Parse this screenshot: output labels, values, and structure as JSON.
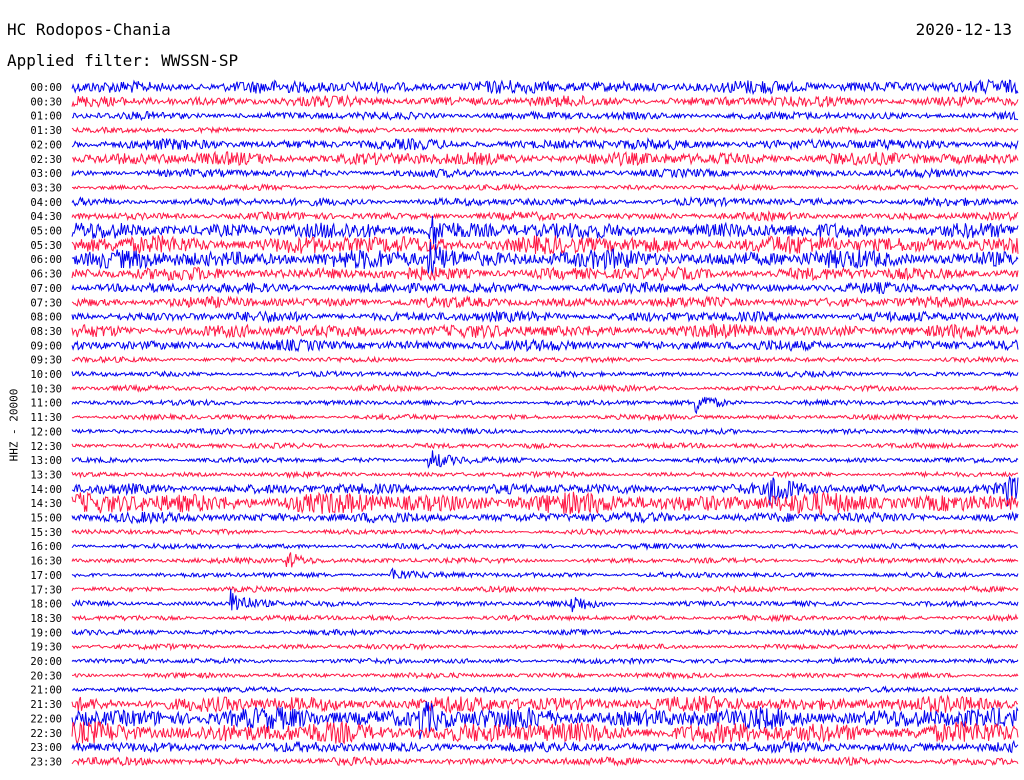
{
  "header": {
    "station": "HC Rodopos-Chania",
    "date": "2020-12-13",
    "filter": "Applied filter: WWSSN-SP"
  },
  "chart_data": {
    "type": "line",
    "title": "HC Rodopos-Chania",
    "ylabel": "HHZ - 20000",
    "colors": [
      "#0000ee",
      "#ff1744"
    ],
    "y_tick_labels": [
      "00:00",
      "00:30",
      "01:00",
      "01:30",
      "02:00",
      "02:30",
      "03:00",
      "03:30",
      "04:00",
      "04:30",
      "05:00",
      "05:30",
      "06:00",
      "06:30",
      "07:00",
      "07:30",
      "08:00",
      "08:30",
      "09:00",
      "09:30",
      "10:00",
      "10:30",
      "11:00",
      "11:30",
      "12:00",
      "12:30",
      "13:00",
      "13:30",
      "14:00",
      "14:30",
      "15:00",
      "15:30",
      "16:00",
      "16:30",
      "17:00",
      "17:30",
      "18:00",
      "18:30",
      "19:00",
      "19:30",
      "20:00",
      "20:30",
      "21:00",
      "21:30",
      "22:00",
      "22:30",
      "23:00",
      "23:30"
    ],
    "noise_level": [
      5,
      4,
      3,
      2,
      4,
      5,
      3,
      2,
      3,
      3,
      6,
      7,
      7,
      5,
      4,
      4,
      4,
      5,
      4,
      2,
      2,
      2,
      2,
      2,
      2,
      2,
      2,
      2,
      4,
      8,
      4,
      2,
      2,
      2,
      2,
      2,
      2,
      2,
      2,
      2,
      2,
      2,
      2,
      6,
      8,
      8,
      4,
      3
    ],
    "events": [
      {
        "row": 10,
        "x": 0.38,
        "amp": 14
      },
      {
        "row": 12,
        "x": 0.38,
        "amp": 14
      },
      {
        "row": 26,
        "x": 0.38,
        "amp": 10
      },
      {
        "row": 28,
        "x": 0.74,
        "amp": 16
      },
      {
        "row": 28,
        "x": 0.99,
        "amp": 12
      },
      {
        "row": 33,
        "x": 0.23,
        "amp": 8
      },
      {
        "row": 34,
        "x": 0.34,
        "amp": 6
      },
      {
        "row": 36,
        "x": 0.17,
        "amp": 14
      },
      {
        "row": 36,
        "x": 0.53,
        "amp": 8
      },
      {
        "row": 22,
        "x": 0.66,
        "amp": 10
      },
      {
        "row": 44,
        "x": 0.37,
        "amp": 16
      }
    ]
  }
}
